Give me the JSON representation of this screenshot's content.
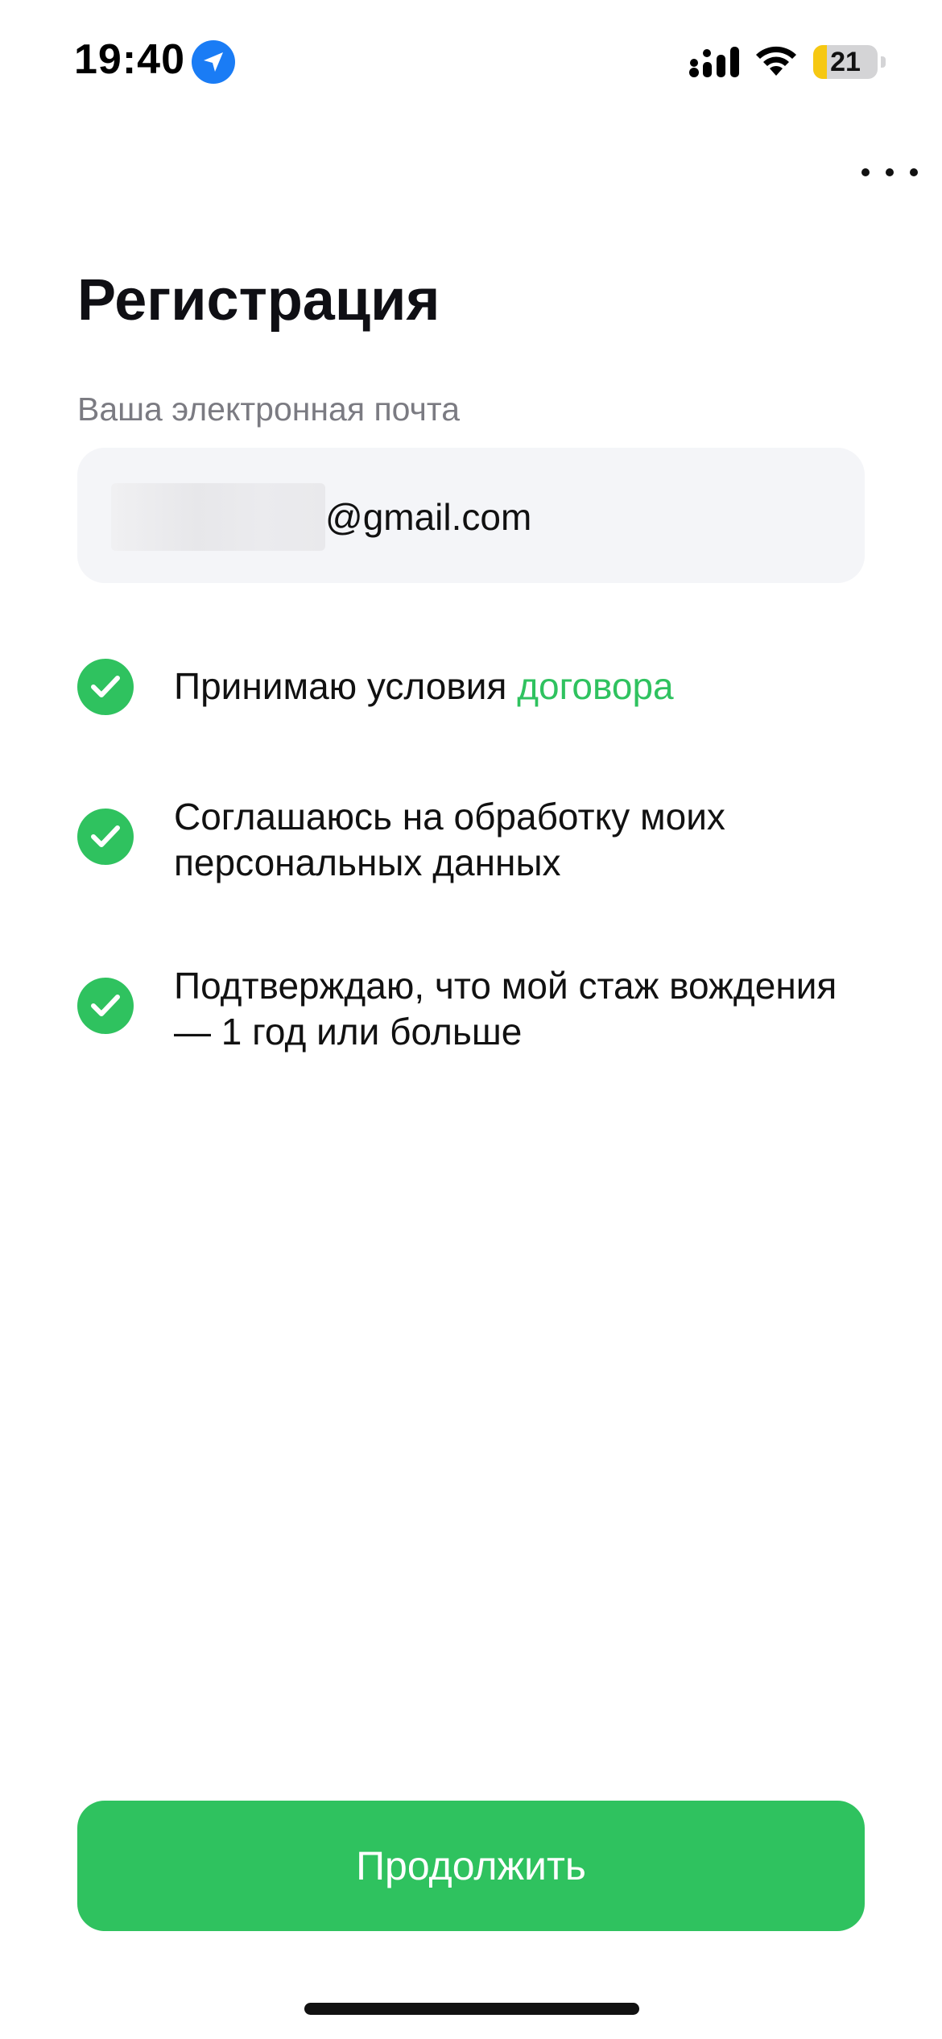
{
  "status_bar": {
    "time": "19:40",
    "battery_level": "21",
    "battery_fraction": 0.21
  },
  "header": {
    "more_icon": "ellipsis-icon"
  },
  "page": {
    "title": "Регистрация"
  },
  "email": {
    "label": "Ваша электронная почта",
    "value_visible": "@gmail.com"
  },
  "consents": [
    {
      "text": "Принимаю условия ",
      "link_text": "договора",
      "checked": true
    },
    {
      "text": "Соглашаюсь на обработку моих персональных данных",
      "checked": true
    },
    {
      "text": "Подтверждаю, что мой стаж вождения — 1 год или больше",
      "checked": true
    }
  ],
  "footer": {
    "continue_label": "Продолжить"
  },
  "colors": {
    "accent": "#2fc25f",
    "location": "#1a7cf5",
    "battery_low": "#f6c812",
    "field_bg": "#f4f5f8",
    "label_gray": "#7b7b82"
  }
}
